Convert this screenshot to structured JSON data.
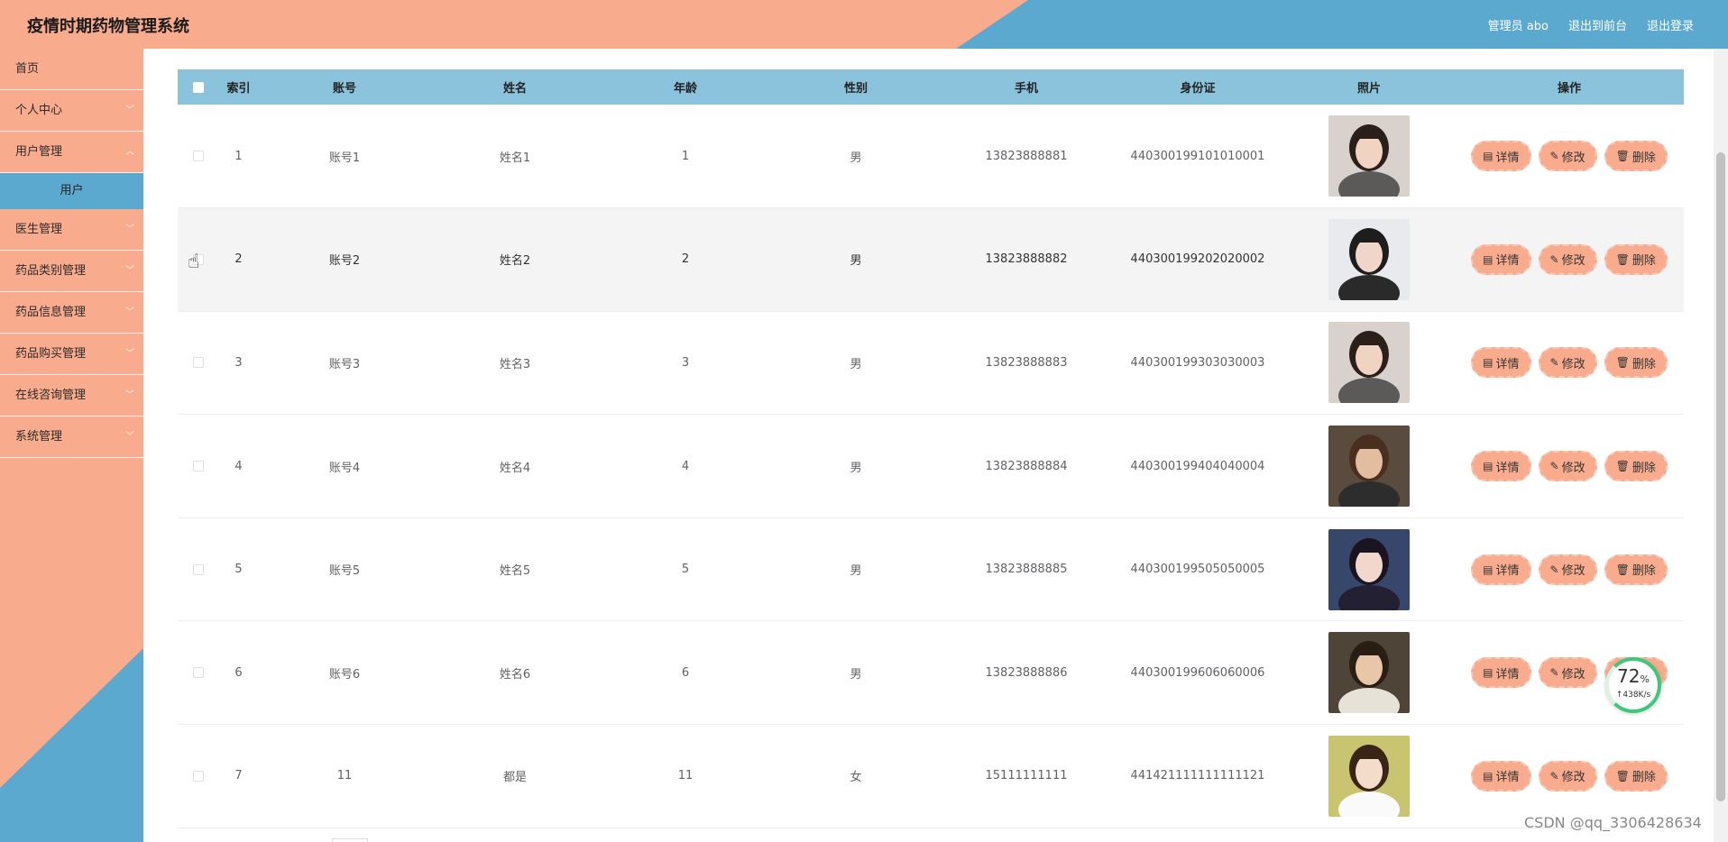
{
  "header": {
    "title": "疫情时期药物管理系统",
    "user_label": "管理员 abo",
    "front_label": "退出到前台",
    "logout_label": "退出登录"
  },
  "sidebar": {
    "items": [
      {
        "label": "首页",
        "has_arrow": false
      },
      {
        "label": "个人中心",
        "has_arrow": true
      },
      {
        "label": "用户管理",
        "has_arrow": true
      },
      {
        "label": "医生管理",
        "has_arrow": true
      },
      {
        "label": "药品类别管理",
        "has_arrow": true
      },
      {
        "label": "药品信息管理",
        "has_arrow": true
      },
      {
        "label": "药品购买管理",
        "has_arrow": true
      },
      {
        "label": "在线咨询管理",
        "has_arrow": true
      },
      {
        "label": "系统管理",
        "has_arrow": true
      }
    ],
    "submenu_active": "用户"
  },
  "table": {
    "columns": [
      "索引",
      "账号",
      "姓名",
      "年龄",
      "性别",
      "手机",
      "身份证",
      "照片",
      "操作"
    ],
    "rows": [
      {
        "index": "1",
        "account": "账号1",
        "name": "姓名1",
        "age": "1",
        "gender": "男",
        "phone": "13823888881",
        "id_card": "440300199101010001"
      },
      {
        "index": "2",
        "account": "账号2",
        "name": "姓名2",
        "age": "2",
        "gender": "男",
        "phone": "13823888882",
        "id_card": "440300199202020002"
      },
      {
        "index": "3",
        "account": "账号3",
        "name": "姓名3",
        "age": "3",
        "gender": "男",
        "phone": "13823888883",
        "id_card": "440300199303030003"
      },
      {
        "index": "4",
        "account": "账号4",
        "name": "姓名4",
        "age": "4",
        "gender": "男",
        "phone": "13823888884",
        "id_card": "440300199404040004"
      },
      {
        "index": "5",
        "account": "账号5",
        "name": "姓名5",
        "age": "5",
        "gender": "男",
        "phone": "13823888885",
        "id_card": "440300199505050005"
      },
      {
        "index": "6",
        "account": "账号6",
        "name": "姓名6",
        "age": "6",
        "gender": "男",
        "phone": "13823888886",
        "id_card": "440300199606060006"
      },
      {
        "index": "7",
        "account": "11",
        "name": "都是",
        "age": "11",
        "gender": "女",
        "phone": "15111111111",
        "id_card": "441421111111111121"
      }
    ],
    "actions": {
      "detail": "详情",
      "edit": "修改",
      "delete": "删除"
    }
  },
  "speed_widget": {
    "percent": "72",
    "percent_unit": "%",
    "rate": "↑438K/s"
  },
  "watermark": "CSDN @qq_3306428634",
  "colors": {
    "peach": "#f9ab8e",
    "blue": "#5ca9cf",
    "table_header": "#8bc3dd"
  }
}
